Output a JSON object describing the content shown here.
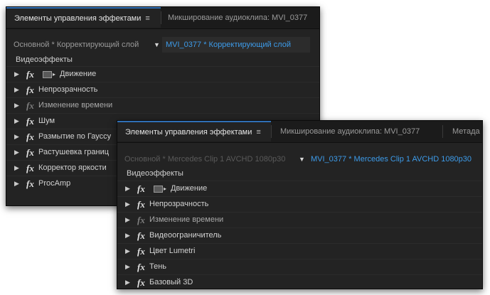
{
  "panel_back": {
    "tabs": {
      "effects": "Элементы управления эффектами",
      "menu": "≡",
      "mixer": "Микширование аудиоклипа: MVI_0377"
    },
    "source": "Основной * Корректирующий слой",
    "dropdown": "▼",
    "clip": "MVI_0377 * Корректирующий слой",
    "section": "Видеоэффекты",
    "effects": [
      {
        "label": "Движение",
        "fx": "fx",
        "arrow": "▶"
      },
      {
        "label": "Непрозрачность",
        "fx": "fx",
        "arrow": "▶"
      },
      {
        "label": "Изменение времени",
        "fx": "fx",
        "arrow": "▶"
      },
      {
        "label": "Шум",
        "fx": "fx",
        "arrow": "▶"
      },
      {
        "label": "Размытие по Гауссу",
        "fx": "fx",
        "arrow": "▶"
      },
      {
        "label": "Растушевка границ",
        "fx": "fx",
        "arrow": "▶"
      },
      {
        "label": "Корректор яркости",
        "fx": "fx",
        "arrow": "▶"
      },
      {
        "label": "ProcAmp",
        "fx": "fx",
        "arrow": "▶"
      }
    ]
  },
  "panel_front": {
    "tabs": {
      "effects": "Элементы управления эффектами",
      "menu": "≡",
      "mixer": "Микширование аудиоклипа: MVI_0377",
      "metadata": "Метада"
    },
    "source": "Основной * Mercedes Clip 1 AVCHD 1080p30",
    "dropdown": "▼",
    "clip": "MVI_0377 * Mercedes Clip 1 AVCHD 1080p30",
    "section": "Видеоэффекты",
    "effects": [
      {
        "label": "Движение",
        "fx": "fx",
        "arrow": "▶"
      },
      {
        "label": "Непрозрачность",
        "fx": "fx",
        "arrow": "▶"
      },
      {
        "label": "Изменение времени",
        "fx": "fx",
        "arrow": "▶"
      },
      {
        "label": "Видеоограничитель",
        "fx": "fx",
        "arrow": "▶"
      },
      {
        "label": "Цвет Lumetri",
        "fx": "fx",
        "arrow": "▶"
      },
      {
        "label": "Тень",
        "fx": "fx",
        "arrow": "▶"
      },
      {
        "label": "Базовый 3D",
        "fx": "fx",
        "arrow": "▶"
      }
    ]
  },
  "motion_icon_arrow": "▸",
  "colors": {
    "accent_blue": "#3d9be9",
    "panel_bg": "#232323",
    "active_tab_line": "#2f6fb5"
  }
}
